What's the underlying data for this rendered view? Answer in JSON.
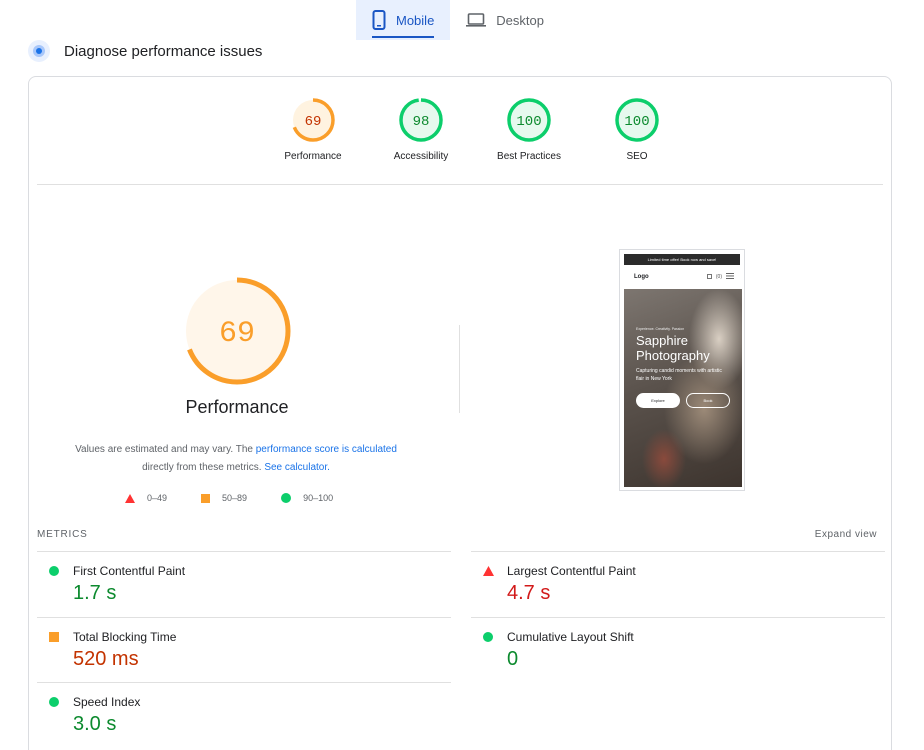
{
  "tabs": {
    "mobile": "Mobile",
    "desktop": "Desktop"
  },
  "diagnose_title": "Diagnose performance issues",
  "categories": [
    {
      "label": "Performance",
      "score": "69",
      "status": "average",
      "fraction": 0.69,
      "color": "#fa9e2a"
    },
    {
      "label": "Accessibility",
      "score": "98",
      "status": "pass",
      "fraction": 0.98,
      "color": "#0cce6b"
    },
    {
      "label": "Best Practices",
      "score": "100",
      "status": "pass",
      "fraction": 1.0,
      "color": "#0cce6b"
    },
    {
      "label": "SEO",
      "score": "100",
      "status": "pass",
      "fraction": 1.0,
      "color": "#0cce6b"
    }
  ],
  "main_gauge": {
    "score": "69",
    "title": "Performance",
    "fraction": 0.69,
    "color": "#fa9e2a"
  },
  "description": {
    "prefix": "Values are estimated and may vary. The ",
    "link1": "performance score is calculated",
    "middle": " directly from these metrics. ",
    "link2": "See calculator."
  },
  "legend": {
    "fail": "0–49",
    "average": "50–89",
    "pass": "90–100"
  },
  "screenshot": {
    "banner": "Limited time offer! Book now and save!",
    "logo": "Logo",
    "nav_icons": "(0)",
    "kicker": "Experience. Creativity. Passion",
    "headline_line1": "Sapphire",
    "headline_line2": "Photography",
    "subtext": "Capturing candid moments with artistic flair in New York",
    "button_primary": "Explore",
    "button_secondary": "Book"
  },
  "metrics": {
    "header": "METRICS",
    "expand": "Expand view",
    "items": [
      {
        "label": "First Contentful Paint",
        "value": "1.7 s",
        "status": "pass"
      },
      {
        "label": "Largest Contentful Paint",
        "value": "4.7 s",
        "status": "fail"
      },
      {
        "label": "Total Blocking Time",
        "value": "520 ms",
        "status": "average"
      },
      {
        "label": "Cumulative Layout Shift",
        "value": "0",
        "status": "pass"
      },
      {
        "label": "Speed Index",
        "value": "3.0 s",
        "status": "pass"
      }
    ]
  },
  "colors": {
    "pass": "#0cce6b",
    "average": "#fa9e2a",
    "fail": "#ff3333",
    "link": "#1a73e8",
    "tab_active": "#1a56c4"
  }
}
